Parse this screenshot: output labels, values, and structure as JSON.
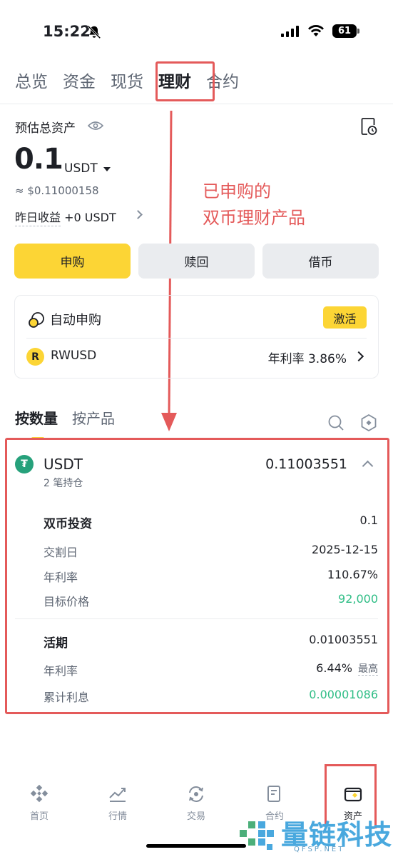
{
  "status_bar": {
    "time": "15:22",
    "battery": "61"
  },
  "top_tabs": [
    {
      "label": "总览"
    },
    {
      "label": "资金"
    },
    {
      "label": "现货"
    },
    {
      "label": "理财"
    },
    {
      "label": "合约"
    }
  ],
  "top_tabs_active": "理财",
  "assets": {
    "label": "预估总资产",
    "value": "0.1",
    "unit": "USDT",
    "approx": "≈ $0.11000158",
    "yesterday_label": "昨日收益",
    "yesterday_value": "+0 USDT"
  },
  "annotation": {
    "line1": "已申购的",
    "line2": "双币理财产品"
  },
  "actions": {
    "subscribe": "申购",
    "redeem": "赎回",
    "borrow": "借币"
  },
  "auto_subscribe": {
    "title": "自动申购",
    "activate": "激活",
    "asset_logo": "R",
    "asset": "RWUSD",
    "rate": "年利率 3.86%"
  },
  "section_tabs": [
    {
      "label": "按数量"
    },
    {
      "label": "按产品"
    }
  ],
  "holding": {
    "asset": "USDT",
    "positions": "2 笔持仓",
    "total": "0.11003551",
    "dual": {
      "title": "双币投资",
      "amount": "0.1",
      "settle_label": "交割日",
      "settle_value": "2025-12-15",
      "apr_label": "年利率",
      "apr_value": "110.67%",
      "target_label": "目标价格",
      "target_value": "92,000"
    },
    "flexible": {
      "title": "活期",
      "amount": "0.01003551",
      "apr_label": "年利率",
      "apr_value": "6.44%",
      "apr_max": "最高",
      "interest_label": "累计利息",
      "interest_value": "0.00001086"
    }
  },
  "bottom_nav": [
    {
      "label": "首页"
    },
    {
      "label": "行情"
    },
    {
      "label": "交易"
    },
    {
      "label": "合约"
    },
    {
      "label": "资产"
    }
  ],
  "watermark": {
    "text": "量链科技",
    "sub": "QFSP.NET"
  },
  "colors": {
    "accent": "#fcd535",
    "annotation": "#e45a5a",
    "positive": "#2ebd85",
    "tether": "#26a17b"
  }
}
